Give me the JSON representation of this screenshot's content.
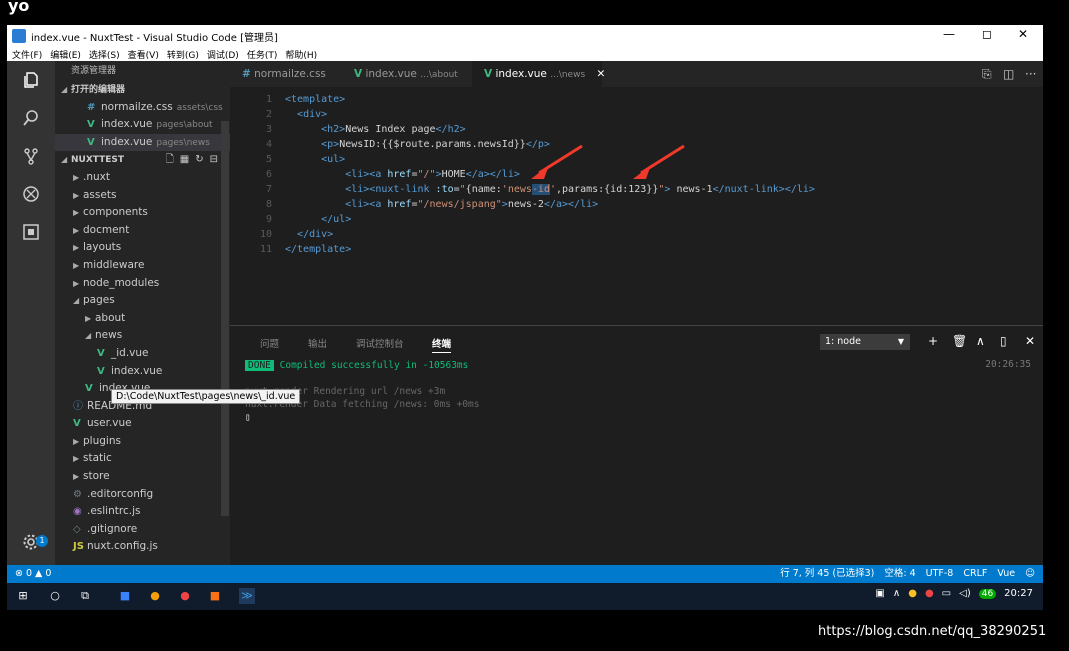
{
  "top": {
    "label": "yo"
  },
  "window": {
    "title": "index.vue - NuxtTest - Visual Studio Code [管理员]",
    "minimize": "—",
    "maximize": "◻",
    "close": "✕",
    "menu": [
      "文件(F)",
      "编辑(E)",
      "选择(S)",
      "查看(V)",
      "转到(G)",
      "调试(D)",
      "任务(T)",
      "帮助(H)"
    ]
  },
  "sidebar": {
    "header": "资源管理器",
    "open_editors_title": "打开的编辑器",
    "open_editors": [
      {
        "icon": "#",
        "name": "normailze.css",
        "desc": "assets\\css",
        "type": "css"
      },
      {
        "icon": "V",
        "name": "index.vue",
        "desc": "pages\\about",
        "type": "vue"
      },
      {
        "icon": "V",
        "name": "index.vue",
        "desc": "pages\\news",
        "type": "vue"
      }
    ],
    "project_title": "NUXTTEST",
    "tree": [
      {
        "name": ".nuxt",
        "twisty": "▶",
        "indent": 1
      },
      {
        "name": "assets",
        "twisty": "▶",
        "indent": 1
      },
      {
        "name": "components",
        "twisty": "▶",
        "indent": 1
      },
      {
        "name": "docment",
        "twisty": "▶",
        "indent": 1
      },
      {
        "name": "layouts",
        "twisty": "▶",
        "indent": 1
      },
      {
        "name": "middleware",
        "twisty": "▶",
        "indent": 1
      },
      {
        "name": "node_modules",
        "twisty": "▶",
        "indent": 1
      },
      {
        "name": "pages",
        "twisty": "◢",
        "indent": 1
      },
      {
        "name": "about",
        "twisty": "▶",
        "indent": 2
      },
      {
        "name": "news",
        "twisty": "◢",
        "indent": 2
      },
      {
        "name": "_id.vue",
        "icon": "V",
        "type": "vue",
        "indent": 3
      },
      {
        "name": "index.vue",
        "icon": "V",
        "type": "vue",
        "indent": 3
      },
      {
        "name": "index.vue",
        "icon": "V",
        "type": "vue",
        "indent": 2
      },
      {
        "name": "README.md",
        "icon": "ⓘ",
        "type": "info",
        "indent": 1
      },
      {
        "name": "user.vue",
        "icon": "V",
        "type": "vue",
        "indent": 1
      },
      {
        "name": "plugins",
        "twisty": "▶",
        "indent": 1
      },
      {
        "name": "static",
        "twisty": "▶",
        "indent": 1
      },
      {
        "name": "store",
        "twisty": "▶",
        "indent": 1
      },
      {
        "name": ".editorconfig",
        "icon": "⚙",
        "type": "gear",
        "indent": 1
      },
      {
        "name": ".eslintrc.js",
        "icon": "◉",
        "type": "es",
        "indent": 1
      },
      {
        "name": ".gitignore",
        "icon": "◇",
        "type": "gear",
        "indent": 1
      },
      {
        "name": "nuxt.config.js",
        "icon": "JS",
        "type": "js",
        "indent": 1
      }
    ],
    "tooltip": "D:\\Code\\NuxtTest\\pages\\news\\_id.vue"
  },
  "tabs": [
    {
      "icon": "#",
      "name": "normailze.css",
      "dim": "",
      "type": "css"
    },
    {
      "icon": "V",
      "name": "index.vue",
      "dim": "...\\about",
      "type": "vue"
    },
    {
      "icon": "V",
      "name": "index.vue",
      "dim": "...\\news",
      "type": "vue",
      "active": true
    }
  ],
  "editor": {
    "line_numbers": [
      "1",
      "2",
      "3",
      "4",
      "5",
      "6",
      "7",
      "8",
      "9",
      "10",
      "11"
    ]
  },
  "panel": {
    "tabs": [
      "问题",
      "输出",
      "调试控制台",
      "终端"
    ],
    "terminal_select": "1: node",
    "done": "DONE",
    "compiled": "Compiled successfully in -10563ms",
    "line2": "nuxt:render Rendering url /news +3m",
    "line3": "nuxt:render Data fetching /news: 0ms +0ms",
    "cursor": "▯",
    "time": "20:26:35"
  },
  "statusbar": {
    "left": "⊗ 0  ▲ 0",
    "position": "行 7, 列 45 (已选择3)",
    "spaces": "空格: 4",
    "encoding": "UTF-8",
    "eol": "CRLF",
    "language": "Vue",
    "smiley": "☺"
  },
  "activity": {
    "badge": "1"
  },
  "taskbar": {
    "badge": "46",
    "clock": "20:27"
  },
  "watermark": "https://blog.csdn.net/qq_38290251"
}
